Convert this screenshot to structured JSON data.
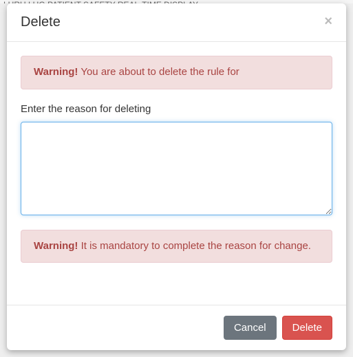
{
  "background_nav": "LURU    LUG    PATIENT SAFETY    REAL-TIME DISPLAY",
  "modal": {
    "title": "Delete",
    "close_symbol": "×",
    "warning1_strong": "Warning!",
    "warning1_text": " You are about to delete the rule for",
    "reason_label": "Enter the reason for deleting",
    "reason_value": "",
    "warning2_strong": "Warning!",
    "warning2_text": " It is mandatory to complete the reason for change.",
    "cancel_label": "Cancel",
    "delete_label": "Delete"
  }
}
